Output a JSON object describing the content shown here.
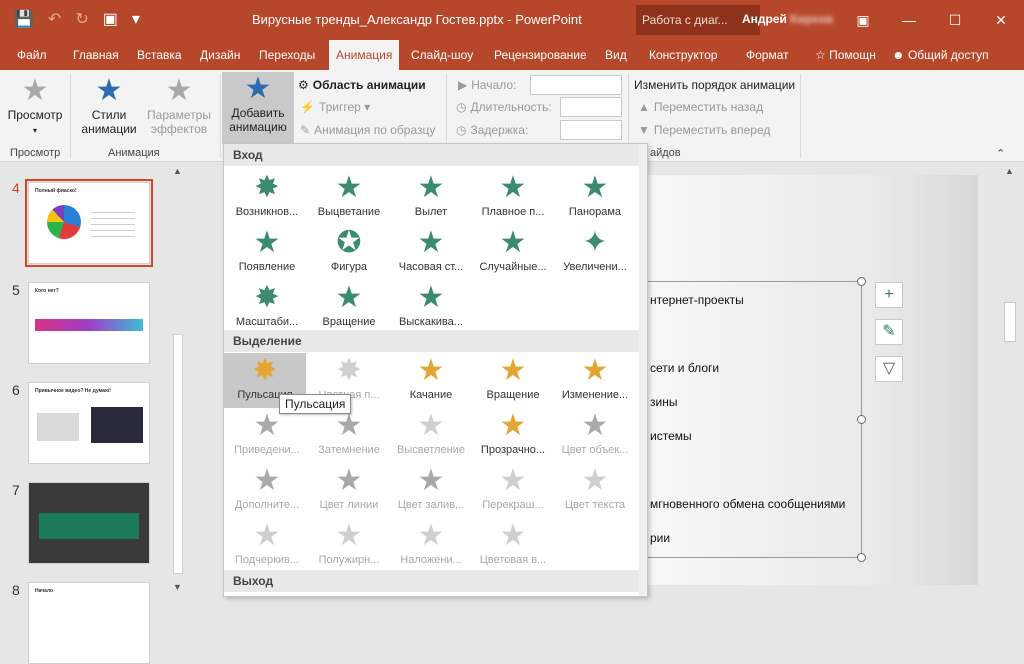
{
  "window": {
    "doc_title": "Вирусные тренды_Александр Гостев.pptx - PowerPoint",
    "context_group": "Работа с диаг...",
    "user_first": "Андрей",
    "user_last": "Киреев"
  },
  "tabs": [
    {
      "label": "Файл"
    },
    {
      "label": "Главная"
    },
    {
      "label": "Вставка"
    },
    {
      "label": "Дизайн"
    },
    {
      "label": "Переходы"
    },
    {
      "label": "Анимация"
    },
    {
      "label": "Слайд-шоу"
    },
    {
      "label": "Рецензирование"
    },
    {
      "label": "Вид"
    },
    {
      "label": "Конструктор"
    },
    {
      "label": "Формат"
    },
    {
      "label": "Помощн"
    },
    {
      "label": "Общий доступ"
    }
  ],
  "ribbon": {
    "preview_label": "Просмотр",
    "preview_group": "Просмотр",
    "styles_label": "Стили анимации",
    "effects_label": "Параметры эффектов",
    "animation_group": "Анимация",
    "add_animation_label": "Добавить анимацию",
    "animation_pane": "Область анимации",
    "trigger": "Триггер",
    "anim_painter": "Анимация по образцу",
    "start_label": "Начало:",
    "duration_label": "Длительность:",
    "delay_label": "Задержка:",
    "reorder_label": "Изменить порядок анимации",
    "move_back": "Переместить назад",
    "move_forward": "Переместить вперед",
    "slides_group_fragment": "айдов"
  },
  "slides": [
    {
      "num": "4",
      "title": "Полный фиаско!"
    },
    {
      "num": "5",
      "title": "Кого нет?"
    },
    {
      "num": "6",
      "title": "Привычное видео? Не думаю!"
    },
    {
      "num": "7",
      "title": ""
    },
    {
      "num": "8",
      "title": "Начало"
    }
  ],
  "slide_text": [
    "нтернет-проекты",
    "сети и блоги",
    "зины",
    "истемы",
    "мгновенного обмена сообщениями",
    "рии"
  ],
  "gallery": {
    "entrance_header": "Вход",
    "emphasis_header": "Выделение",
    "exit_header": "Выход",
    "entrance": [
      "Возникнов...",
      "Выцветание",
      "Вылет",
      "Плавное п...",
      "Панорама",
      "Появление",
      "Фигура",
      "Часовая ст...",
      "Случайные...",
      "Увеличени...",
      "Масштаби...",
      "Вращение",
      "Выскакива..."
    ],
    "emphasis_top": [
      "Пульсация",
      "Цветная п...",
      "Качание",
      "Вращение",
      "Изменение..."
    ],
    "emphasis_disabled": [
      "Приведени...",
      "Затемнение",
      "Высветление",
      "Прозрачно...",
      "Цвет объек...",
      "Дополните...",
      "Цвет линии",
      "Цвет залив...",
      "Перекраш...",
      "Цвет текста",
      "Подчеркив...",
      "Полужирн...",
      "Наложени...",
      "Цветовая в..."
    ],
    "tooltip": "Пульсация"
  },
  "colors": {
    "accent": "#b7472a",
    "entrance_star": "#3b8c6e",
    "emphasis_star": "#e4a632"
  }
}
